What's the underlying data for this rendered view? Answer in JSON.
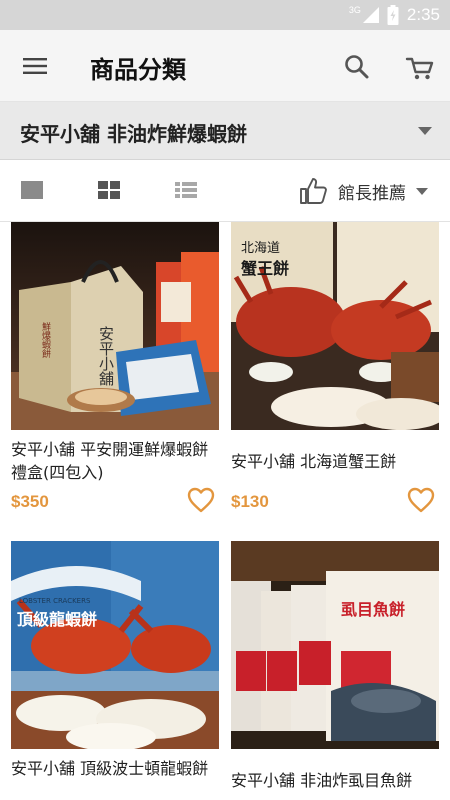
{
  "status_bar": {
    "network": "3G",
    "time": "2:35"
  },
  "app_bar": {
    "title": "商品分類"
  },
  "category": {
    "selected": "安平小舖 非油炸鮮爆蝦餅"
  },
  "sort": {
    "label": "館長推薦"
  },
  "products": [
    {
      "name": "安平小舖 平安開運鮮爆蝦餅禮盒(四包入)",
      "price": "$350"
    },
    {
      "name": "安平小舖 北海道蟹王餅",
      "price": "$130"
    },
    {
      "name": "安平小舖 頂級波士頓龍蝦餅",
      "price": ""
    },
    {
      "name": "安平小舖 非油炸虱目魚餅",
      "price": ""
    }
  ],
  "image_text": {
    "p1": [
      "安平小舖",
      "鮮爆蝦餅"
    ],
    "p2": [
      "北海道",
      "蟹王餅"
    ],
    "p3": [
      "頂級龍蝦餅",
      "LOBSTER CRACKERS"
    ],
    "p4": [
      "虱目魚餅"
    ]
  },
  "colors": {
    "accent": "#e3963e",
    "app_bar": "#f5f5f5",
    "category_bar": "#e9e9e9",
    "icon": "#555555"
  }
}
